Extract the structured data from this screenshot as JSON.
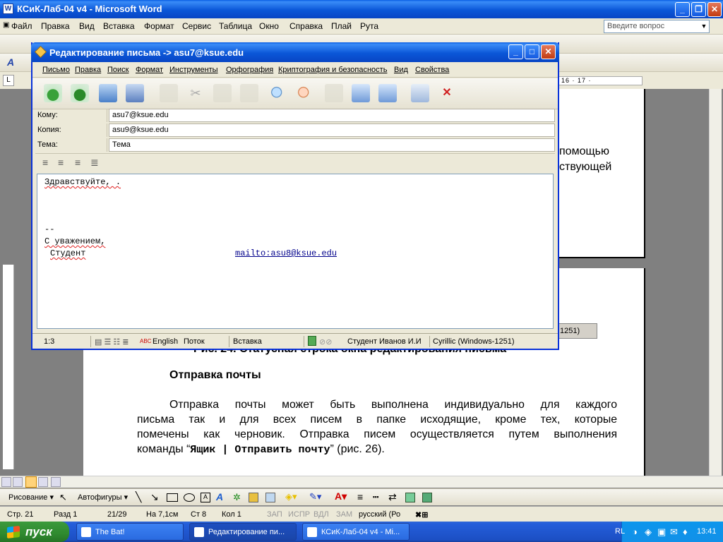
{
  "word": {
    "title": "КСиК-Лаб-04 v4 - Microsoft Word",
    "menu": [
      "Файл",
      "Правка",
      "Вид",
      "Вставка",
      "Формат",
      "Сервис",
      "Таблица",
      "Окно",
      "Справка",
      "Плай",
      "Рута"
    ],
    "help_placeholder": "Введите вопрос",
    "ruler_right": "16 · 17 ·",
    "doc_right_line1": "помощью",
    "doc_right_line2": "ствующей",
    "caption": "Рис. 24. Статусная строка окна редактирования письма",
    "section_heading": "Отправка почты",
    "para_line1": "Отправка почты может быть выполнена индивидуально для каждого",
    "para_line2": "письма так и для всех писем в папке исходящие, кроме тех, которые",
    "para_line3": "помечены как черновик. Отправка писем осуществляется путем выполнения",
    "para_line4_pre": "команды “",
    "para_line4_cmd": "Ящик | Отправить почту",
    "para_line4_post": "” (рис. 26).",
    "behind_status_fragment": "1251)",
    "status": {
      "page": "Стр. 21",
      "section": "Разд 1",
      "pages": "21/29",
      "at": "На 7,1см",
      "line": "Ст 8",
      "col": "Кол 1",
      "rec": "ЗАП",
      "trk": "ИСПР",
      "ext": "ВДЛ",
      "ovr": "ЗАМ",
      "lang": "русский (Ро"
    },
    "draw_toolbar": {
      "drawing": "Рисование ▾",
      "autoshapes": "Автофигуры ▾"
    }
  },
  "dialog": {
    "title": "Редактирование письма -> asu7@ksue.edu",
    "menu": [
      "Письмо",
      "Правка",
      "Поиск",
      "Формат",
      "Инструменты",
      "Орфография",
      "Криптография и безопасность",
      "Вид",
      "Свойства"
    ],
    "fields": [
      {
        "label": "Кому:",
        "value": "asu7@ksue.edu"
      },
      {
        "label": "Копия:",
        "value": "asu9@ksue.edu"
      },
      {
        "label": "Тема:",
        "value": "Тема"
      }
    ],
    "body": {
      "greeting": "Здравствуйте, .",
      "signature_sep": "--",
      "regards": "С уважением,",
      "name": "Студент",
      "mailto": "mailto:asu8@ksue.edu"
    },
    "status": {
      "pos": "1:3",
      "lang": "English",
      "mode": "Поток",
      "insert": "Вставка",
      "user": "Студент Иванов И.И",
      "charset": "Cyrillic (Windows-1251)"
    }
  },
  "taskbar": {
    "start": "пуск",
    "tasks": [
      "The Bat!",
      "Редактирование пи...",
      "КСиК-Лаб-04 v4 - Mi..."
    ],
    "lang": "RL",
    "time": "13:41"
  }
}
